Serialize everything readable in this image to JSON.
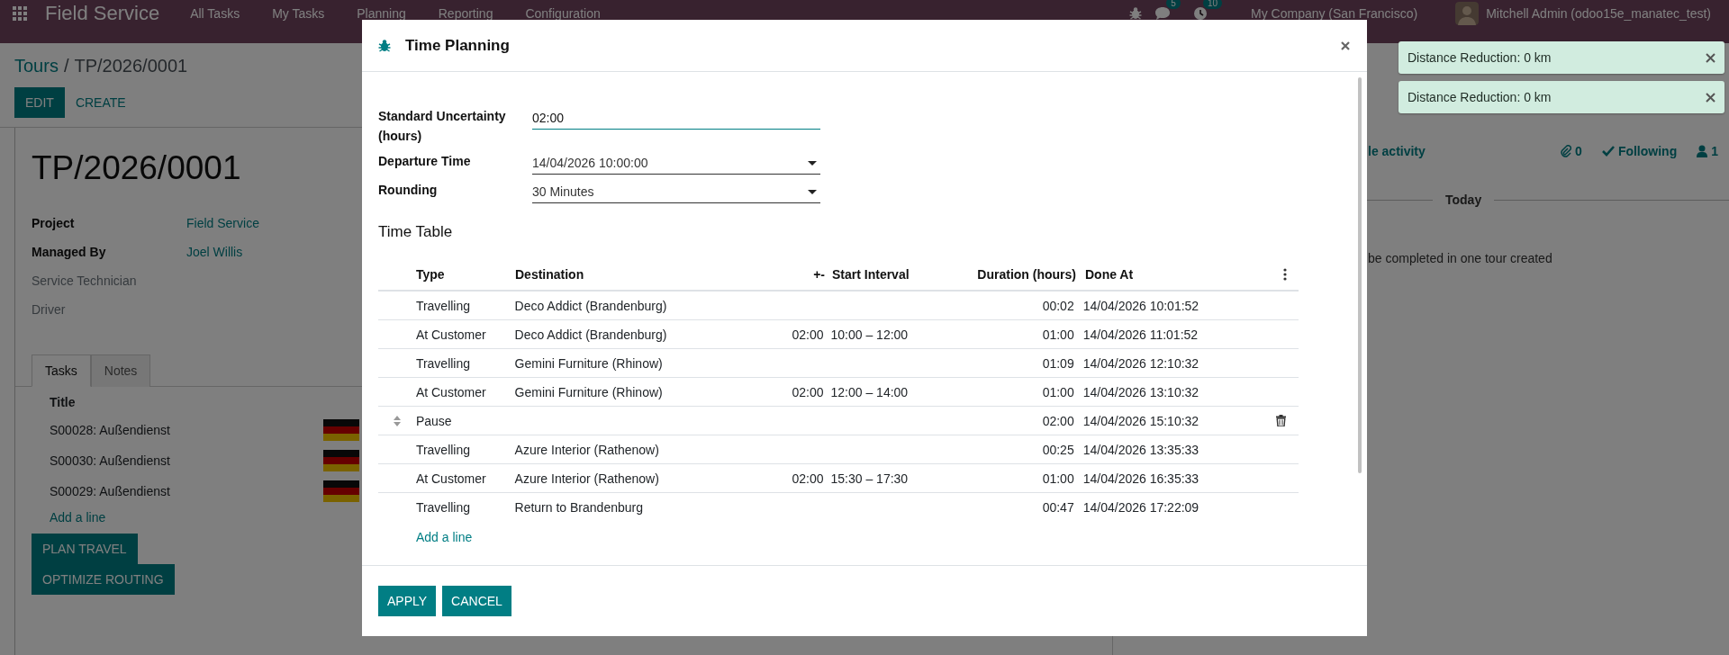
{
  "navbar": {
    "app_name": "Field Service",
    "menus": [
      "All Tasks",
      "My Tasks",
      "Planning",
      "Reporting",
      "Configuration"
    ],
    "chat_count": "5",
    "activity_count": "10",
    "company": "My Company (San Francisco)",
    "user": "Mitchell Admin (odoo15e_manatec_test)"
  },
  "breadcrumb": {
    "parent": "Tours",
    "separator": "/",
    "current": "TP/2026/0001"
  },
  "actions": [
    {
      "label": "EDIT",
      "kind": "primary"
    },
    {
      "label": "CREATE",
      "kind": "link"
    }
  ],
  "record": {
    "title": "TP/2026/0001",
    "fields": [
      {
        "label": "Project",
        "value": "Field Service",
        "required": true
      },
      {
        "label": "Managed By",
        "value": "Joel Willis",
        "required": true
      },
      {
        "label": "Service Technician",
        "required": false
      },
      {
        "label": "Driver",
        "required": false
      }
    ]
  },
  "tabs": [
    {
      "label": "Tasks",
      "selected": true
    },
    {
      "label": "Notes",
      "selected": false
    }
  ],
  "tasks": {
    "column": "Title",
    "rows": [
      "S00028: Außendienst",
      "S00030: Außendienst",
      "S00029: Außendienst"
    ],
    "add_line": "Add a line"
  },
  "record_buttons": [
    "PLAN TRAVEL",
    "OPTIMIZE ROUTING"
  ],
  "chatter": {
    "schedule": "le activity",
    "attachments": "0",
    "follow": "Following",
    "followers": "1",
    "date_separator": "Today",
    "message": "be completed in one tour created"
  },
  "dialog": {
    "title": "Time Planning",
    "fields": [
      {
        "label": "Standard Uncertainty (hours)",
        "value": "02:00",
        "kind": "text",
        "focused": true
      },
      {
        "label": "Departure Time",
        "value": "14/04/2026 10:00:00",
        "kind": "select",
        "focused": false
      },
      {
        "label": "Rounding",
        "value": "30 Minutes",
        "kind": "select",
        "focused": false
      }
    ],
    "section": "Time Table",
    "columns": [
      "Type",
      "Destination",
      "+-",
      "Start Interval",
      "Duration (hours)",
      "Done At"
    ],
    "rows": [
      {
        "type": "Travelling",
        "destination": "Deco Addict (Brandenburg)",
        "duration": "00:02",
        "done_at": "14/04/2026 10:01:52",
        "hovered": false
      },
      {
        "type": "At Customer",
        "destination": "Deco Addict (Brandenburg)",
        "uncertainty": "02:00",
        "interval": "10:00 – 12:00",
        "duration": "01:00",
        "done_at": "14/04/2026 11:01:52",
        "hovered": false
      },
      {
        "type": "Travelling",
        "destination": "Gemini Furniture (Rhinow)",
        "duration": "01:09",
        "done_at": "14/04/2026 12:10:32",
        "hovered": false
      },
      {
        "type": "At Customer",
        "destination": "Gemini Furniture (Rhinow)",
        "uncertainty": "02:00",
        "interval": "12:00 – 14:00",
        "duration": "01:00",
        "done_at": "14/04/2026 13:10:32",
        "hovered": false
      },
      {
        "type": "Pause",
        "duration": "02:00",
        "done_at": "14/04/2026 15:10:32",
        "hovered": true
      },
      {
        "type": "Travelling",
        "destination": "Azure Interior (Rathenow)",
        "duration": "00:25",
        "done_at": "14/04/2026 13:35:33",
        "hovered": false
      },
      {
        "type": "At Customer",
        "destination": "Azure Interior (Rathenow)",
        "uncertainty": "02:00",
        "interval": "15:30 – 17:30",
        "duration": "01:00",
        "done_at": "14/04/2026 16:35:33",
        "hovered": false
      },
      {
        "type": "Travelling",
        "destination": "Return to Brandenburg",
        "duration": "00:47",
        "done_at": "14/04/2026 17:22:09",
        "hovered": false
      }
    ],
    "add_line": "Add a line",
    "buttons": [
      "APPLY",
      "CANCEL"
    ]
  },
  "notifications": [
    {
      "message": "Distance Reduction: 0 km"
    },
    {
      "message": "Distance Reduction: 0 km"
    }
  ]
}
